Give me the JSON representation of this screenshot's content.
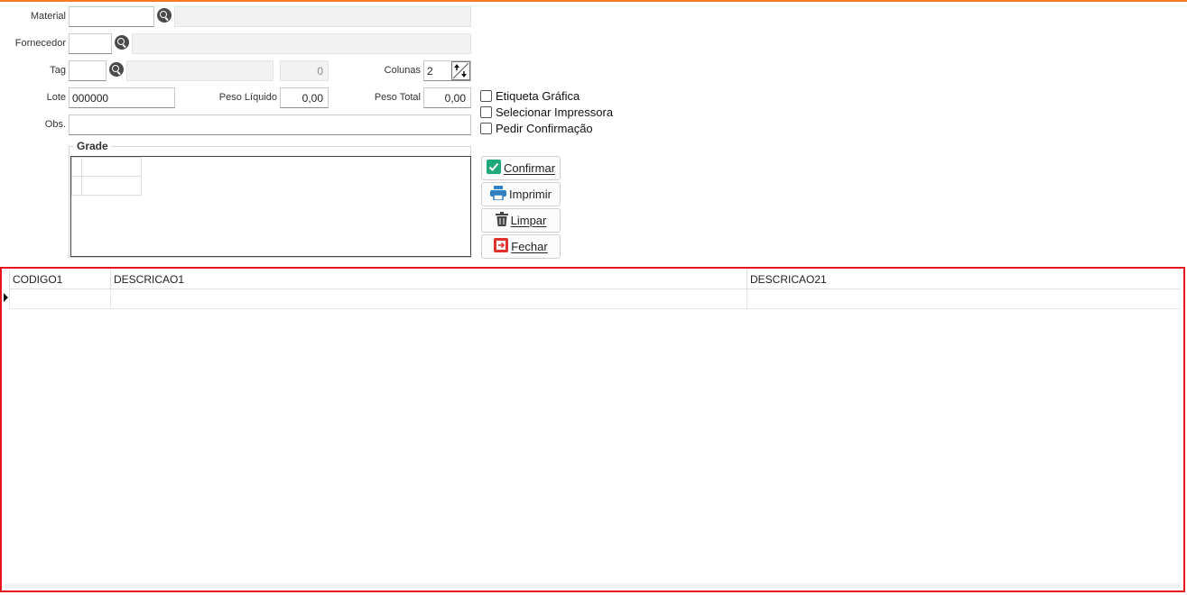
{
  "form": {
    "material": {
      "label": "Material",
      "value": "",
      "description": ""
    },
    "fornecedor": {
      "label": "Fornecedor",
      "value": "",
      "description": ""
    },
    "tag": {
      "label": "Tag",
      "value": "",
      "description": "",
      "count": "0"
    },
    "colunas": {
      "label": "Colunas",
      "value": "2"
    },
    "lote": {
      "label": "Lote",
      "value": "000000"
    },
    "peso_liquido": {
      "label": "Peso Líquido",
      "value": "0,00"
    },
    "peso_total": {
      "label": "Peso Total",
      "value": "0,00"
    },
    "obs": {
      "label": "Obs.",
      "value": ""
    }
  },
  "options": {
    "etiqueta_grafica": {
      "label": "Etiqueta Gráfica",
      "checked": false
    },
    "selecionar_impressora": {
      "label": "Selecionar Impressora",
      "checked": false
    },
    "pedir_confirmacao": {
      "label": "Pedir Confirmação",
      "checked": false
    }
  },
  "grade": {
    "title": "Grade"
  },
  "buttons": {
    "confirmar": {
      "label": "Confirmar",
      "icon": "check-icon",
      "color": "#1fa87a"
    },
    "imprimir": {
      "label": "Imprimir",
      "icon": "printer-icon",
      "color": "#2f7fc1"
    },
    "limpar": {
      "label": "Limpar",
      "icon": "trash-icon",
      "color": "#444444"
    },
    "fechar": {
      "label": "Fechar",
      "icon": "exit-icon",
      "color": "#e0312c"
    }
  },
  "table": {
    "columns": [
      "CODIGO1",
      "DESCRICAO1",
      "DESCRICAO21"
    ],
    "rows": [
      [
        "",
        "",
        ""
      ]
    ]
  },
  "colors": {
    "accent": "#f47b20",
    "highlight_border": "#e8141c"
  }
}
